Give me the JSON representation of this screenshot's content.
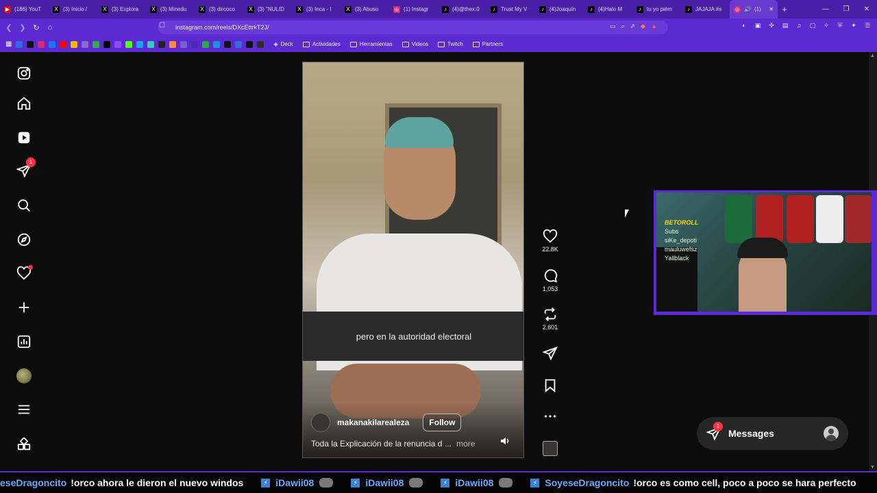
{
  "browser": {
    "tabs": [
      {
        "label": "(186) YouT",
        "fav_color": "#ff0000",
        "fav": "▶"
      },
      {
        "label": "(3) Inicio /",
        "fav_color": "#000000",
        "fav": "X"
      },
      {
        "label": "(3) Explora",
        "fav_color": "#000000",
        "fav": "X"
      },
      {
        "label": "(3) Minedu",
        "fav_color": "#000000",
        "fav": "X"
      },
      {
        "label": "(3) dircoco",
        "fav_color": "#000000",
        "fav": "X"
      },
      {
        "label": "(3) \"NULID",
        "fav_color": "#000000",
        "fav": "X"
      },
      {
        "label": "(3) Inca - I",
        "fav_color": "#000000",
        "fav": "X"
      },
      {
        "label": "(3) Abuso",
        "fav_color": "#000000",
        "fav": "X"
      },
      {
        "label": "(1) Instagr",
        "fav_color": "#d62976",
        "fav": "◎"
      },
      {
        "label": "(4)@thex.0",
        "fav_color": "#000000",
        "fav": "♪"
      },
      {
        "label": "Trust My V",
        "fav_color": "#000000",
        "fav": "♪"
      },
      {
        "label": "(4)Joaquín",
        "fav_color": "#000000",
        "fav": "♪"
      },
      {
        "label": "(4)Halo M",
        "fav_color": "#000000",
        "fav": "♪"
      },
      {
        "label": "tu yo piém",
        "fav_color": "#000000",
        "fav": "♪"
      },
      {
        "label": "JAJAJA #s",
        "fav_color": "#000000",
        "fav": "♪"
      }
    ],
    "active_tab": {
      "label": "(1)",
      "fav_color": "#d62976",
      "fav": "◎",
      "speaker": "🔊",
      "close": "✕"
    },
    "new_tab": "+",
    "window_controls": {
      "minimize": "—",
      "restore": "❐",
      "close": "✕"
    },
    "url": "instagram.com/reels/DXcEttrkT2J/",
    "bookmarks": [
      "Deck",
      "Actividades",
      "Herramientas",
      "Videos",
      "Twitch",
      "Partners"
    ]
  },
  "sidebar": {
    "items": [
      {
        "name": "instagram-logo-icon"
      },
      {
        "name": "home-icon"
      },
      {
        "name": "reels-icon"
      },
      {
        "name": "direct-messages-icon",
        "badge": "1"
      },
      {
        "name": "search-icon"
      },
      {
        "name": "explore-icon"
      },
      {
        "name": "notifications-icon"
      },
      {
        "name": "create-icon"
      },
      {
        "name": "dashboard-icon"
      },
      {
        "name": "profile-avatar"
      },
      {
        "name": "more-menu-icon"
      },
      {
        "name": "also-from-meta-icon"
      }
    ]
  },
  "reel": {
    "caption": "pero en la autoridad electoral",
    "username": "makanakilarealeza",
    "follow_label": "Follow",
    "description": "Toda la Explicación de la renuncia d",
    "ellipsis": "...",
    "more_label": "more"
  },
  "actions": {
    "likes": "22.8K",
    "comments": "1,053",
    "reposts": "2,601"
  },
  "webcam": {
    "brand": "BETOROLL",
    "lines": [
      "Subs",
      "siKe_depoti",
      "mauluwefsz",
      "Yallblack"
    ]
  },
  "messages": {
    "label": "Messages",
    "badge": "1"
  },
  "ticker": [
    {
      "user": "eseDragoncito",
      "msg": "!orco ahora le dieron el nuevo windos"
    },
    {
      "user": "iDawii08",
      "msg": ""
    },
    {
      "user": "iDawii08",
      "msg": ""
    },
    {
      "user": "iDawii08",
      "msg": ""
    },
    {
      "user": "SoyeseDragoncito",
      "msg": "!orco es como cell, poco a poco se hara perfecto"
    }
  ],
  "colors": {
    "accent_purple": "#5b2ad0",
    "notification_red": "#ff3040",
    "ticker_user": "#6fa8ff"
  }
}
